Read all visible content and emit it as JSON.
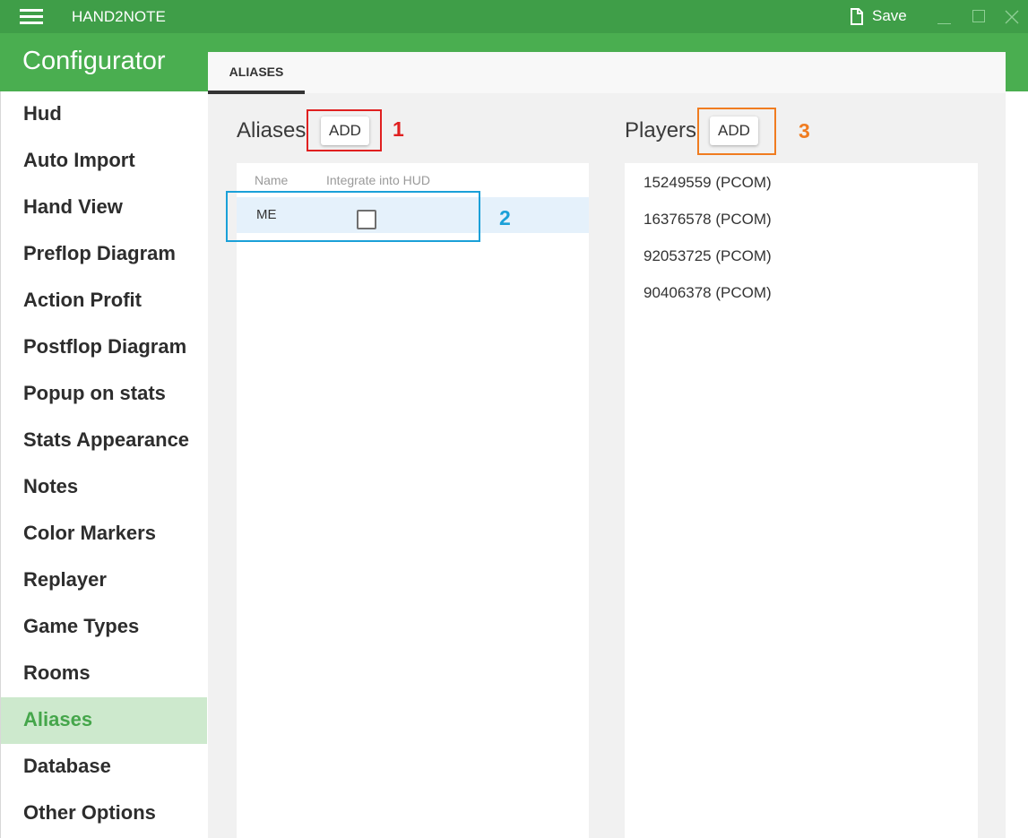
{
  "app": {
    "title": "HAND2NOTE",
    "save_label": "Save",
    "accent_color": "#4aae50",
    "titlebar_color": "#3f9e48"
  },
  "header": {
    "title": "Configurator"
  },
  "sidebar": {
    "items": [
      {
        "label": "Hud"
      },
      {
        "label": "Auto Import"
      },
      {
        "label": "Hand View"
      },
      {
        "label": "Preflop Diagram"
      },
      {
        "label": "Action Profit"
      },
      {
        "label": "Postflop Diagram"
      },
      {
        "label": "Popup on stats"
      },
      {
        "label": "Stats Appearance"
      },
      {
        "label": "Notes"
      },
      {
        "label": "Color Markers"
      },
      {
        "label": "Replayer"
      },
      {
        "label": "Game Types"
      },
      {
        "label": "Rooms"
      },
      {
        "label": "Aliases",
        "active": true
      },
      {
        "label": "Database"
      },
      {
        "label": "Other Options"
      }
    ]
  },
  "tabs": [
    {
      "label": "ALIASES",
      "active": true
    }
  ],
  "aliases": {
    "title": "Aliases",
    "add_label": "ADD",
    "columns": [
      "Name",
      "Integrate into HUD"
    ],
    "rows": [
      {
        "name": "ME",
        "integrate": false
      }
    ]
  },
  "players": {
    "title": "Players",
    "add_label": "ADD",
    "items": [
      "15249559 (PCOM)",
      "16376578 (PCOM)",
      "92053725 (PCOM)",
      "90406378 (PCOM)"
    ]
  },
  "annotations": [
    {
      "label": "1",
      "color": "#e02020"
    },
    {
      "label": "2",
      "color": "#1aa0d8"
    },
    {
      "label": "3",
      "color": "#f07c20"
    }
  ]
}
